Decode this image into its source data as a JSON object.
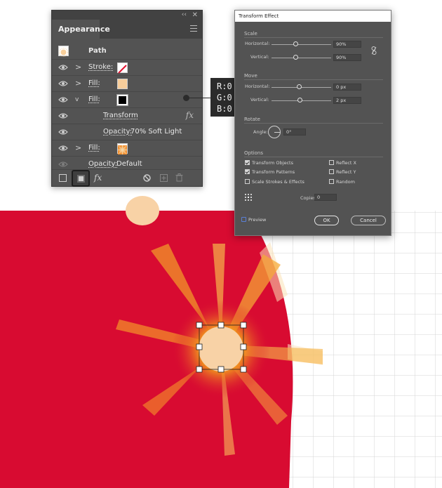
{
  "appearance_panel": {
    "tab_label": "Appearance",
    "collapse_glyph": "‹‹",
    "close_glyph": "✕",
    "rows": [
      {
        "label": "Path",
        "swatch": "#f8cf9a"
      },
      {
        "label": "Stroke:",
        "swatch": "none-red-slash"
      },
      {
        "label": "Fill:",
        "swatch": "#f7cd9b"
      },
      {
        "label": "Fill:",
        "swatch": "#000000"
      },
      {
        "label": "Transform"
      },
      {
        "label": "Opacity:",
        "value": "70% Soft Light"
      },
      {
        "label": "Fill:",
        "swatch": "radial-gradient"
      },
      {
        "label": "Opacity:",
        "value": "Default"
      }
    ],
    "fx_glyph": "fx",
    "chev_right": ">",
    "chev_down": "v"
  },
  "callout": {
    "r": "R:0",
    "g": "G:0",
    "b": "B:0"
  },
  "dialog": {
    "title": "Transform Effect",
    "scale": {
      "section": "Scale",
      "horizontal_label": "Horizontal:",
      "horizontal_value": "90%",
      "vertical_label": "Vertical:",
      "vertical_value": "90%"
    },
    "move": {
      "section": "Move",
      "horizontal_label": "Horizontal:",
      "horizontal_value": "0 px",
      "vertical_label": "Vertical:",
      "vertical_value": "2 px"
    },
    "rotate": {
      "section": "Rotate",
      "angle_label": "Angle:",
      "angle_value": "0°"
    },
    "options": {
      "section": "Options",
      "transform_objects": "Transform Objects",
      "transform_patterns": "Transform Patterns",
      "scale_strokes": "Scale Strokes & Effects",
      "reflect_x": "Reflect X",
      "reflect_y": "Reflect Y",
      "random": "Random",
      "copies_label": "Copies",
      "copies_value": "0"
    },
    "preview_label": "Preview",
    "ok_label": "OK",
    "cancel_label": "Cancel"
  },
  "colors": {
    "artboard_red": "#d80b31",
    "sun_fill": "#f8d2a6",
    "ray_orange": "#f6a21c",
    "panel_bg": "#535353"
  }
}
